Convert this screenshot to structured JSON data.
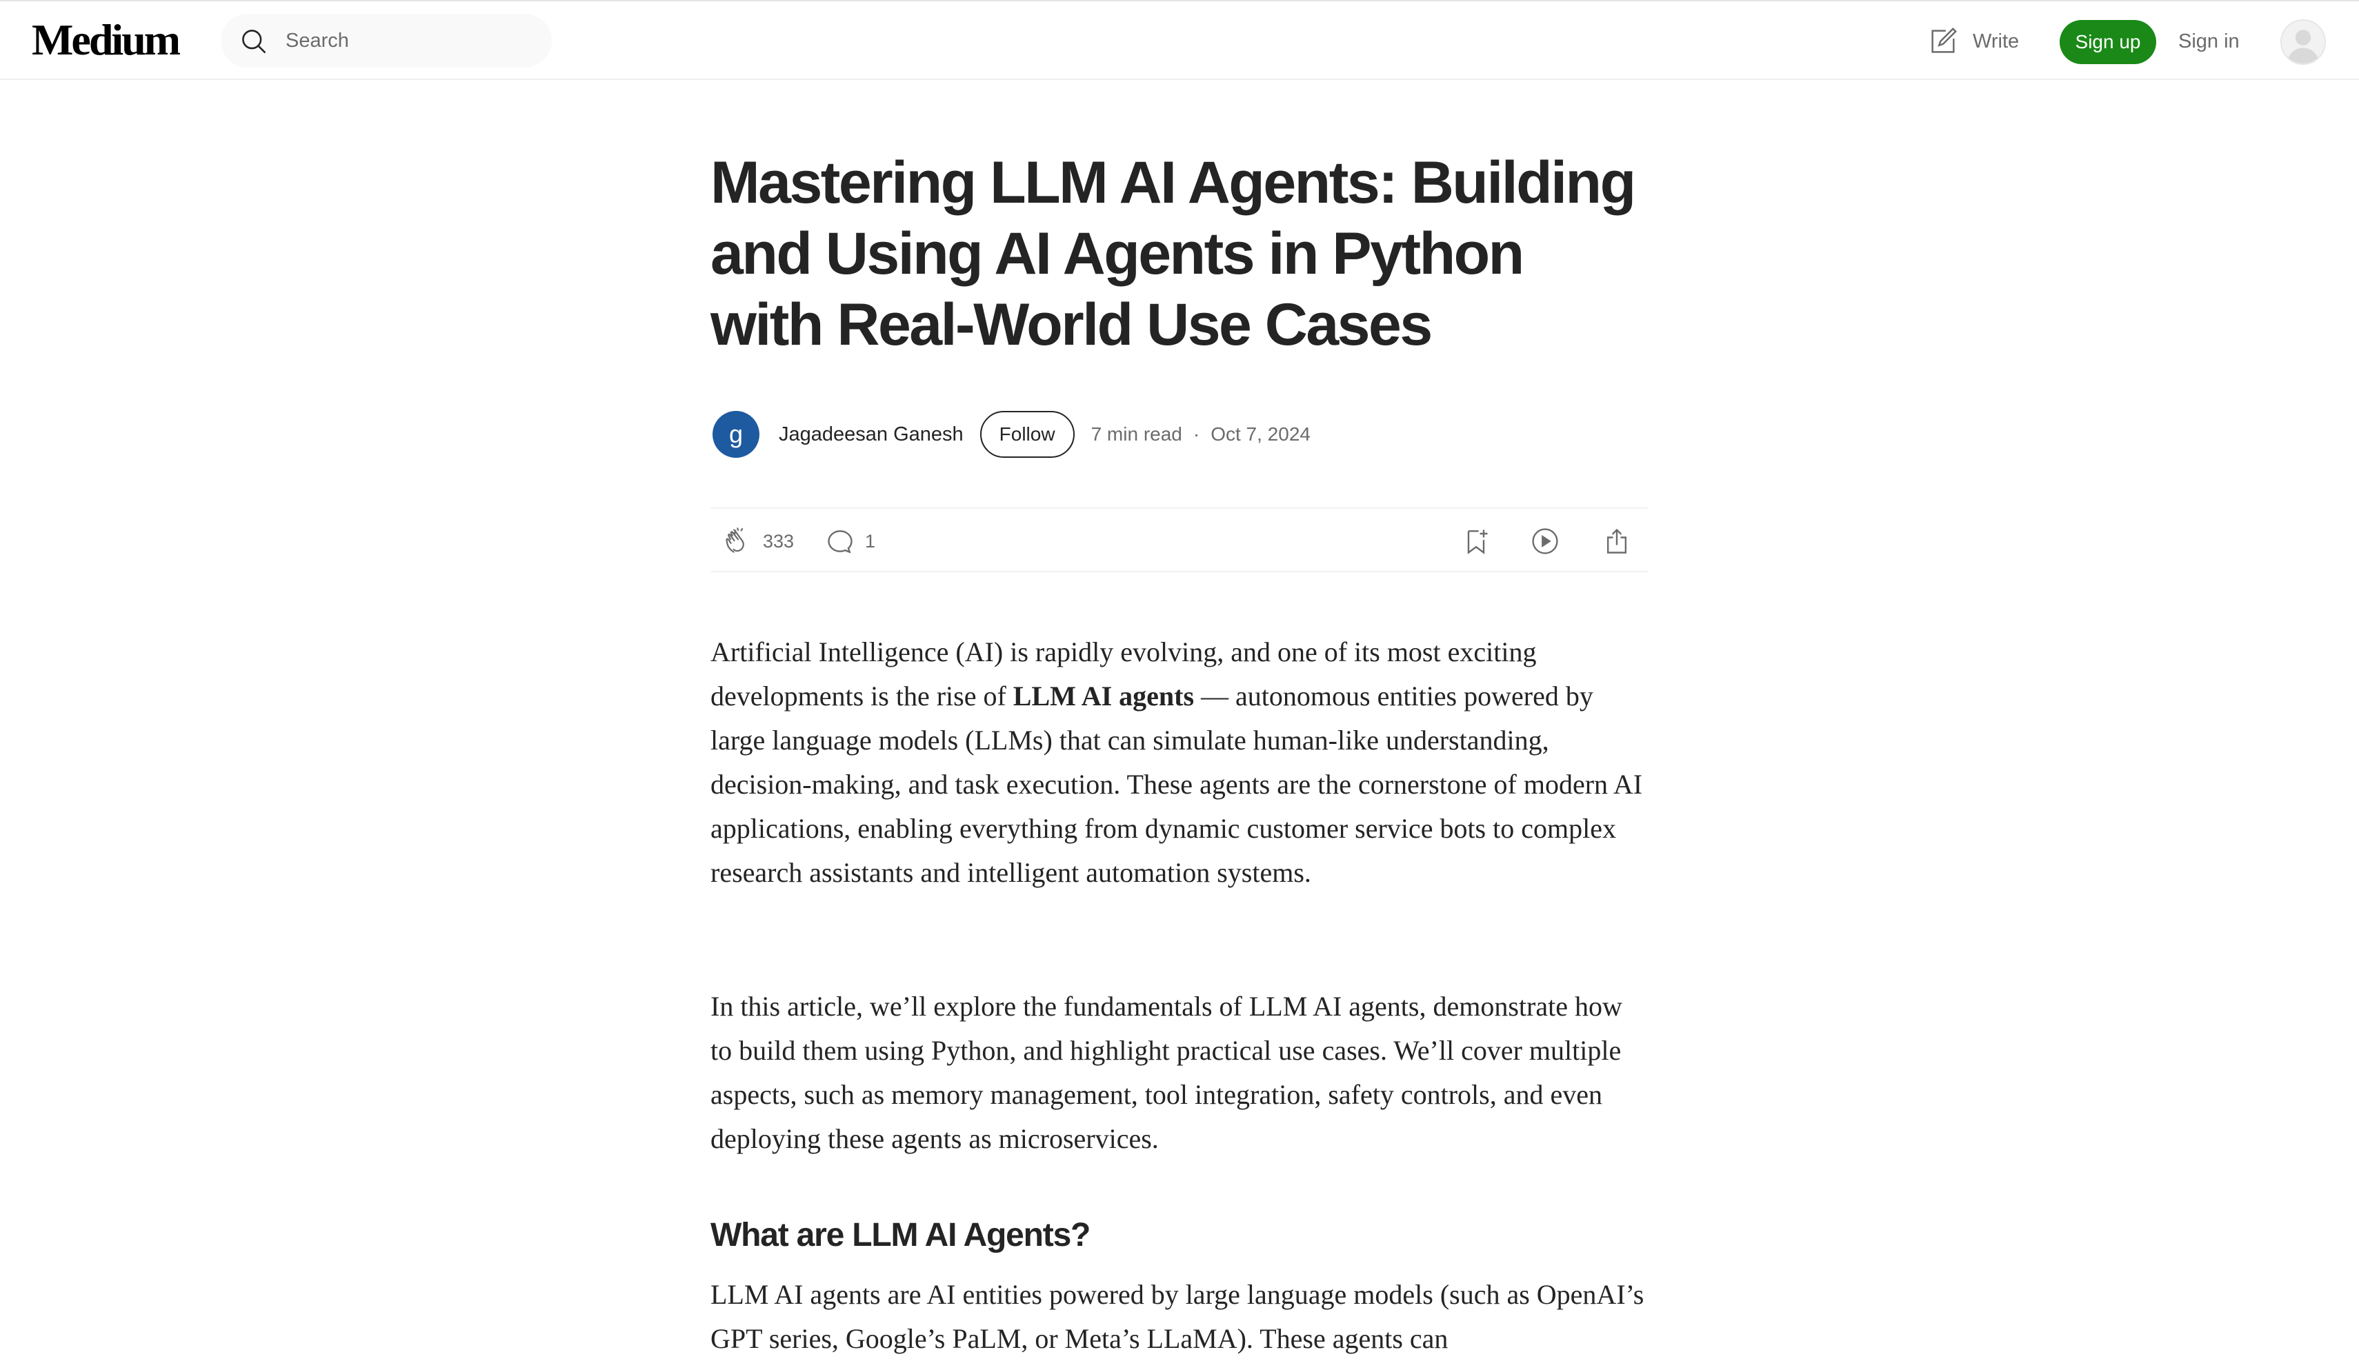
{
  "header": {
    "logo": "Medium",
    "search_placeholder": "Search",
    "write_label": "Write",
    "signup_label": "Sign up",
    "signin_label": "Sign in"
  },
  "article": {
    "title": "Mastering LLM AI Agents: Building and Using AI Agents in Python with Real-World Use Cases",
    "author": {
      "initial": "g",
      "name": "Jagadeesan Ganesh"
    },
    "follow_label": "Follow",
    "read_time": "7 min read",
    "date": "Oct 7, 2024",
    "claps": "333",
    "comments": "1",
    "paragraph1": {
      "before": "Artificial Intelligence (AI) is rapidly evolving, and one of its most exciting developments is the rise of ",
      "bold": "LLM AI agents",
      "after": " — autonomous entities powered by large language models (LLMs) that can simulate human-like understanding, decision-making, and task execution. These agents are the cornerstone of modern AI applications, enabling everything from dynamic customer service bots to complex research assistants and intelligent automation systems."
    },
    "paragraph2": "In this article, we’ll explore the fundamentals of LLM AI agents, demonstrate how to build them using Python, and highlight practical use cases. We’ll cover multiple aspects, such as memory management, tool integration, safety controls, and even deploying these agents as microservices.",
    "section_heading": "What are LLM AI Agents?",
    "paragraph3": "LLM AI agents are AI entities powered by large language models (such as OpenAI’s GPT series, Google’s PaLM, or Meta’s LLaMA). These agents can"
  },
  "colors": {
    "signup_bg": "#1a8917",
    "author_avatar_bg": "#1e5aa0",
    "text": "#242424",
    "muted": "#6b6b6b"
  },
  "icons": [
    "search-icon",
    "write-icon",
    "user-avatar-icon",
    "clap-icon",
    "comment-icon",
    "bookmark-icon",
    "play-icon",
    "share-icon"
  ]
}
